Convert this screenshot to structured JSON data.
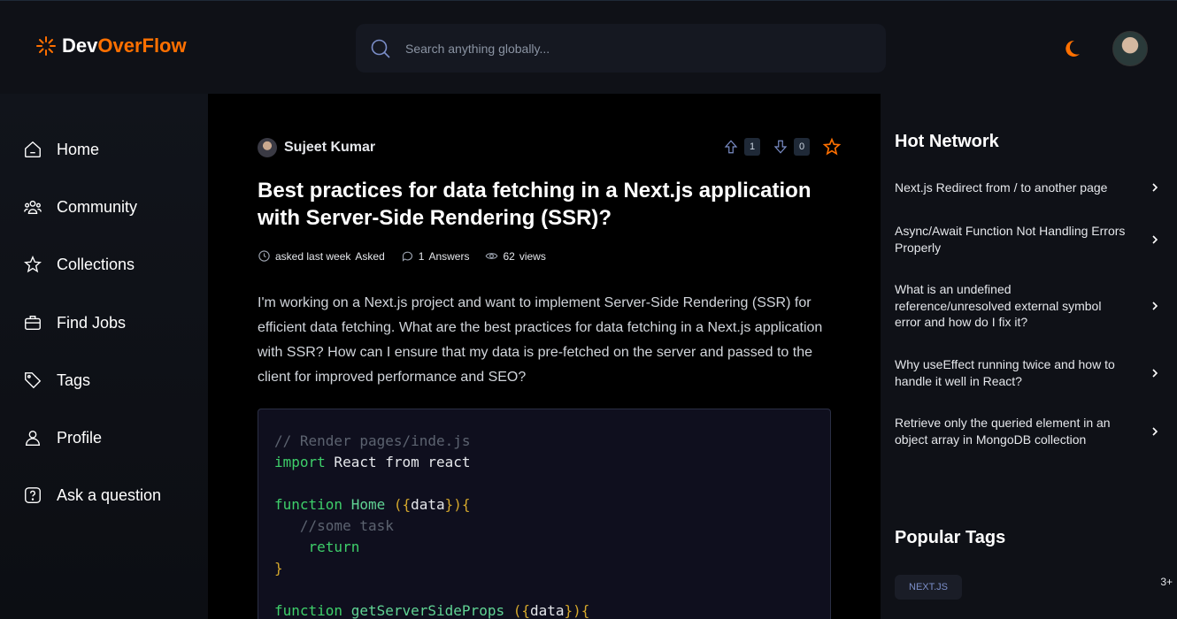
{
  "header": {
    "logo_part1": "Dev",
    "logo_part2": "OverFlow",
    "search_placeholder": "Search anything globally...",
    "accent_color": "#ff7000"
  },
  "sidebar": {
    "items": [
      {
        "label": "Home",
        "icon": "home-icon"
      },
      {
        "label": "Community",
        "icon": "users-icon"
      },
      {
        "label": "Collections",
        "icon": "star-icon"
      },
      {
        "label": "Find Jobs",
        "icon": "suitcase-icon"
      },
      {
        "label": "Tags",
        "icon": "tag-icon"
      },
      {
        "label": "Profile",
        "icon": "user-icon"
      },
      {
        "label": "Ask a question",
        "icon": "question-icon"
      }
    ]
  },
  "question": {
    "author": "Sujeet Kumar",
    "upvotes": "1",
    "downvotes": "0",
    "title": "Best practices for data fetching in a Next.js application with Server-Side Rendering (SSR)?",
    "asked": "asked last week",
    "asked_label": "Asked",
    "answers_count": "1",
    "answers_label": "Answers",
    "views_count": "62",
    "views_label": "views",
    "body": "I'm working on a Next.js project and want to implement Server-Side Rendering (SSR) for efficient data fetching. What are the best practices for data fetching in a Next.js application with SSR? How can I ensure that my data is pre-fetched on the server and passed to the client for improved performance and SEO?",
    "code": {
      "comment1": "// Render pages/inde.js",
      "kw_import": "import",
      "import_rest": " React from react",
      "kw_function": "function",
      "fn_home": " Home ",
      "brace_open": "({",
      "param": "data",
      "brace_close": "}){",
      "comment2": "   //some task",
      "kw_return": "    return",
      "close_brace": "}",
      "fn_gssp": " getServerSideProps "
    }
  },
  "right_sidebar": {
    "hot_title": "Hot Network",
    "hot_items": [
      "Next.js Redirect from / to another page",
      "Async/Await Function Not Handling Errors Properly",
      "What is an undefined reference/unresolved external symbol error and how do I fix it?",
      "Why useEffect running twice and how to handle it well in React?",
      "Retrieve only the queried element in an object array in MongoDB collection"
    ],
    "tags_title": "Popular Tags",
    "tags": [
      {
        "name": "NEXT.JS",
        "count": "3+"
      }
    ]
  }
}
